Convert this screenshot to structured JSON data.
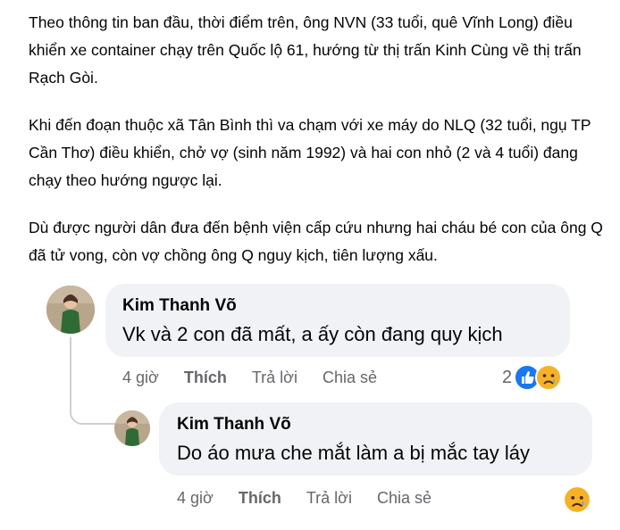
{
  "post": {
    "paragraphs": [
      "Theo thông tin ban đầu, thời điểm trên, ông NVN (33 tuổi, quê Vĩnh Long) điều khiển xe container chạy trên Quốc lộ 61, hướng từ thị trấn Kinh Cùng về thị trấn Rạch Gòi.",
      "Khi đến đoạn thuộc xã Tân Bình thì va chạm với xe máy do NLQ (32 tuổi, ngụ TP Cần Thơ) điều khiển, chở vợ (sinh năm 1992) và hai con nhỏ (2 và 4 tuổi) đang chạy theo hướng ngược lại.",
      "Dù được người dân đưa đến bệnh viện cấp cứu nhưng hai cháu bé con của ông Q đã tử vong, còn vợ chồng ông Q nguy kịch, tiên lượng xấu."
    ]
  },
  "comments": [
    {
      "author": "Kim Thanh Võ",
      "text": "Vk và 2 con đã mất, a ấy còn đang quy kịch",
      "time": "4 giờ",
      "like": "Thích",
      "reply": "Trả lời",
      "share": "Chia sẻ",
      "reaction_count": "2",
      "reactions": [
        "like-icon",
        "sad-icon"
      ]
    },
    {
      "author": "Kim Thanh Võ",
      "text": "Do áo mưa che mắt làm a bị mắc tay láy",
      "time": "4 giờ",
      "like": "Thích",
      "reply": "Trả lời",
      "share": "Chia sẻ",
      "reactions": [
        "sad-icon"
      ]
    }
  ],
  "colors": {
    "bubble": "#f0f2f5",
    "meta_text": "#65676b",
    "like_blue": "#1877f2",
    "sad_yellow": "#f7b125"
  }
}
